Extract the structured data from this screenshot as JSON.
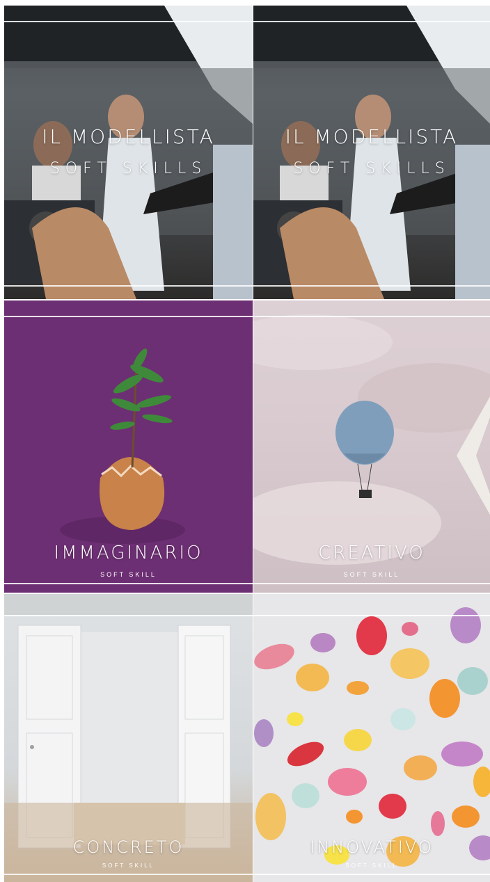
{
  "tiles": [
    {
      "title": "IL MODELLISTA",
      "subtitle": "SOFT SKILLS"
    },
    {
      "title": "IL MODELLISTA",
      "subtitle": "SOFT SKILLS"
    },
    {
      "title": "IMMAGINARIO",
      "subtitle": "SOFT SKILL"
    },
    {
      "title": "CREATIVO",
      "subtitle": "SOFT SKILL"
    },
    {
      "title": "CONCRETO",
      "subtitle": "SOFT SKILL"
    },
    {
      "title": "INNOVATIVO",
      "subtitle": "SOFT SKILL"
    }
  ],
  "icons": {
    "next": "chevron-left-icon"
  }
}
